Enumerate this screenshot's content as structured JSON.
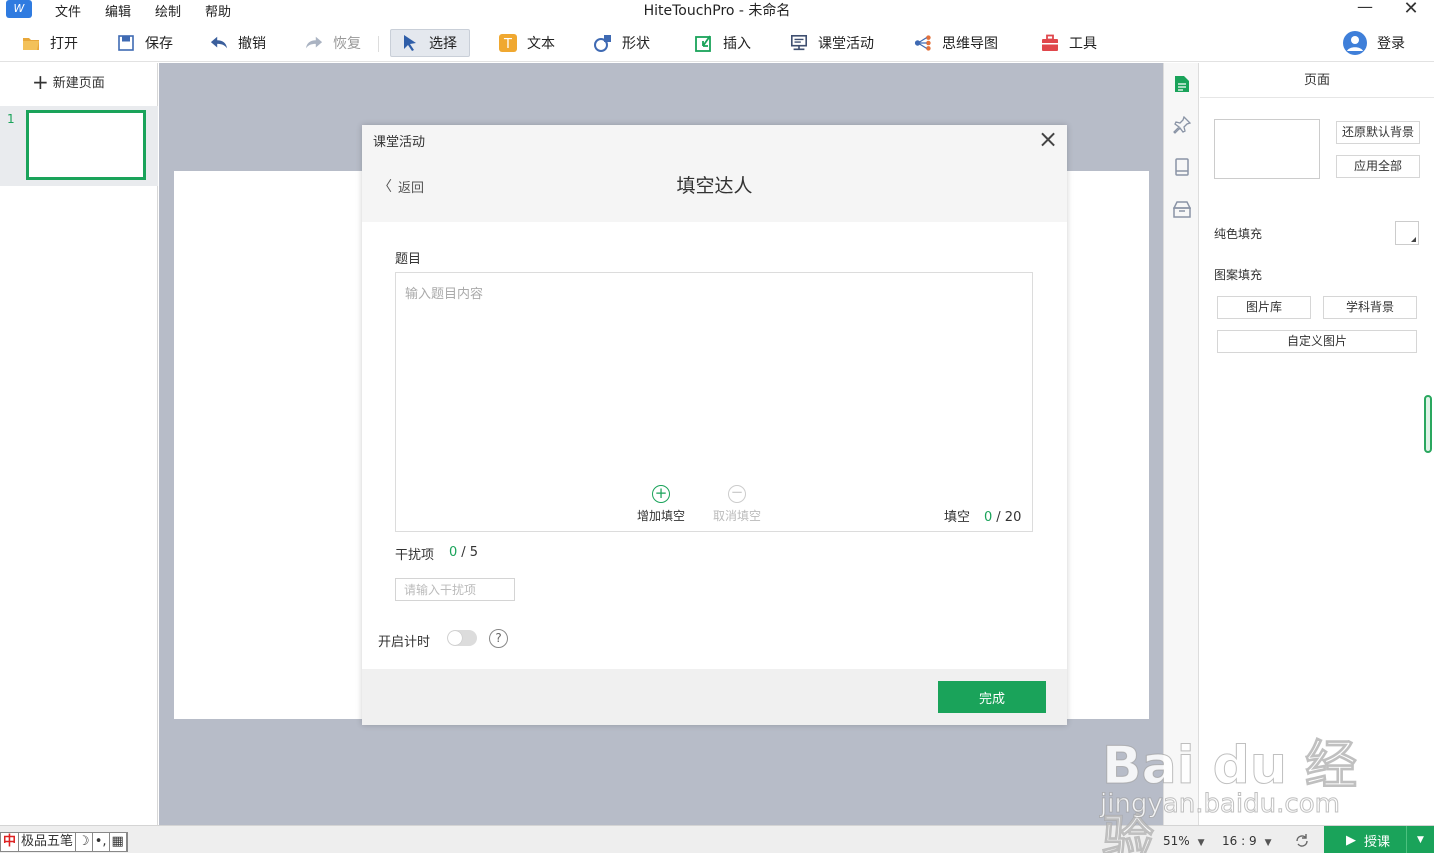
{
  "titlebar": {
    "menus": [
      "文件",
      "编辑",
      "绘制",
      "帮助"
    ],
    "title": "HiteTouchPro - 未命名"
  },
  "toolbar": {
    "open": "打开",
    "save": "保存",
    "undo": "撤销",
    "redo": "恢复",
    "select": "选择",
    "text": "文本",
    "shape": "形状",
    "insert": "插入",
    "activity": "课堂活动",
    "mindmap": "思维导图",
    "tools": "工具",
    "login": "登录"
  },
  "left_panel": {
    "new_page": "新建页面",
    "pages": [
      {
        "number": "1"
      }
    ]
  },
  "dialog": {
    "title": "课堂活动",
    "back": "返回",
    "heading": "填空达人",
    "question_label": "题目",
    "question_placeholder": "输入题目内容",
    "add_blank": "增加填空",
    "cancel_blank": "取消填空",
    "blank_label": "填空",
    "blank_current": "0",
    "blank_total": "/ 20",
    "distractor_label": "干扰项",
    "distractor_current": "0",
    "distractor_total": "/ 5",
    "distractor_placeholder": "请输入干扰项",
    "timer_label": "开启计时",
    "timer_help": "?",
    "done": "完成"
  },
  "properties": {
    "title": "页面",
    "restore_bg": "还原默认背景",
    "apply_all": "应用全部",
    "solid_fill": "纯色填充",
    "pattern_fill": "图案填充",
    "gallery": "图片库",
    "subject_bg": "学科背景",
    "custom_image": "自定义图片"
  },
  "statusbar": {
    "ime": [
      "中",
      "极品五笔",
      "☽",
      "•,",
      "▦"
    ],
    "zoom": "51%",
    "ratio": "16 : 9",
    "teach": "授课"
  },
  "watermark": {
    "logo": "Bai du 经验",
    "sub": "jingyan.baidu.com"
  },
  "colors": {
    "accent": "#1aa35a",
    "canvas_bg": "#b7bcc8",
    "header_bg": "#f5f5f5"
  }
}
